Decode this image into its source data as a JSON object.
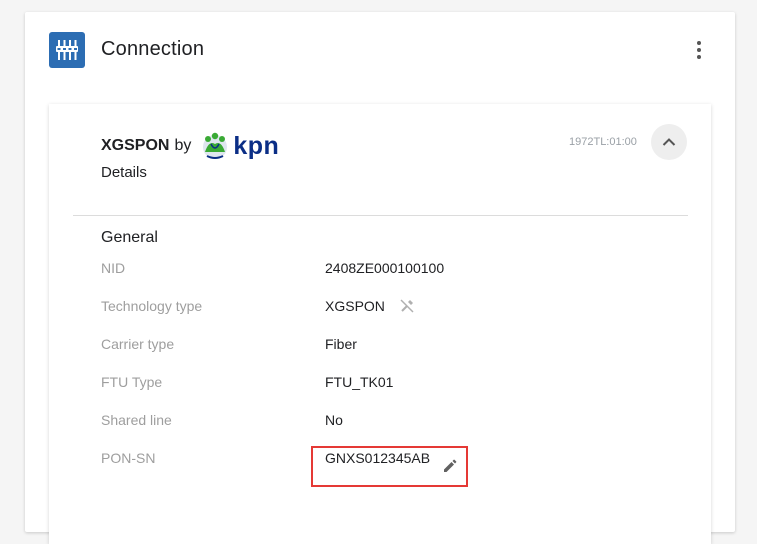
{
  "header": {
    "title": "Connection",
    "icon": "connection-plug-icon",
    "menu_icon": "more-vertical-icon"
  },
  "connection": {
    "technology": "XGSPON",
    "by": "by",
    "provider_logo_text": "kpn",
    "subtitle": "Details",
    "timestamp": "1972TL:01:00",
    "collapse_icon": "chevron-up-icon"
  },
  "general": {
    "title": "General",
    "rows": [
      {
        "label": "NID",
        "value": "2408ZE000100100"
      },
      {
        "label": "Technology type",
        "value": "XGSPON",
        "icon": "fiber-disconnected-icon"
      },
      {
        "label": "Carrier type",
        "value": "Fiber"
      },
      {
        "label": "FTU Type",
        "value": "FTU_TK01"
      },
      {
        "label": "Shared line",
        "value": "No"
      },
      {
        "label": "PON-SN",
        "value": "GNXS012345AB",
        "icon": "edit-pencil-icon"
      }
    ]
  },
  "colors": {
    "brand_icon_bg": "#2c6db3",
    "kpn_blue": "#0b2e86",
    "kpn_green": "#3aaa35",
    "highlight": "#e53935"
  }
}
